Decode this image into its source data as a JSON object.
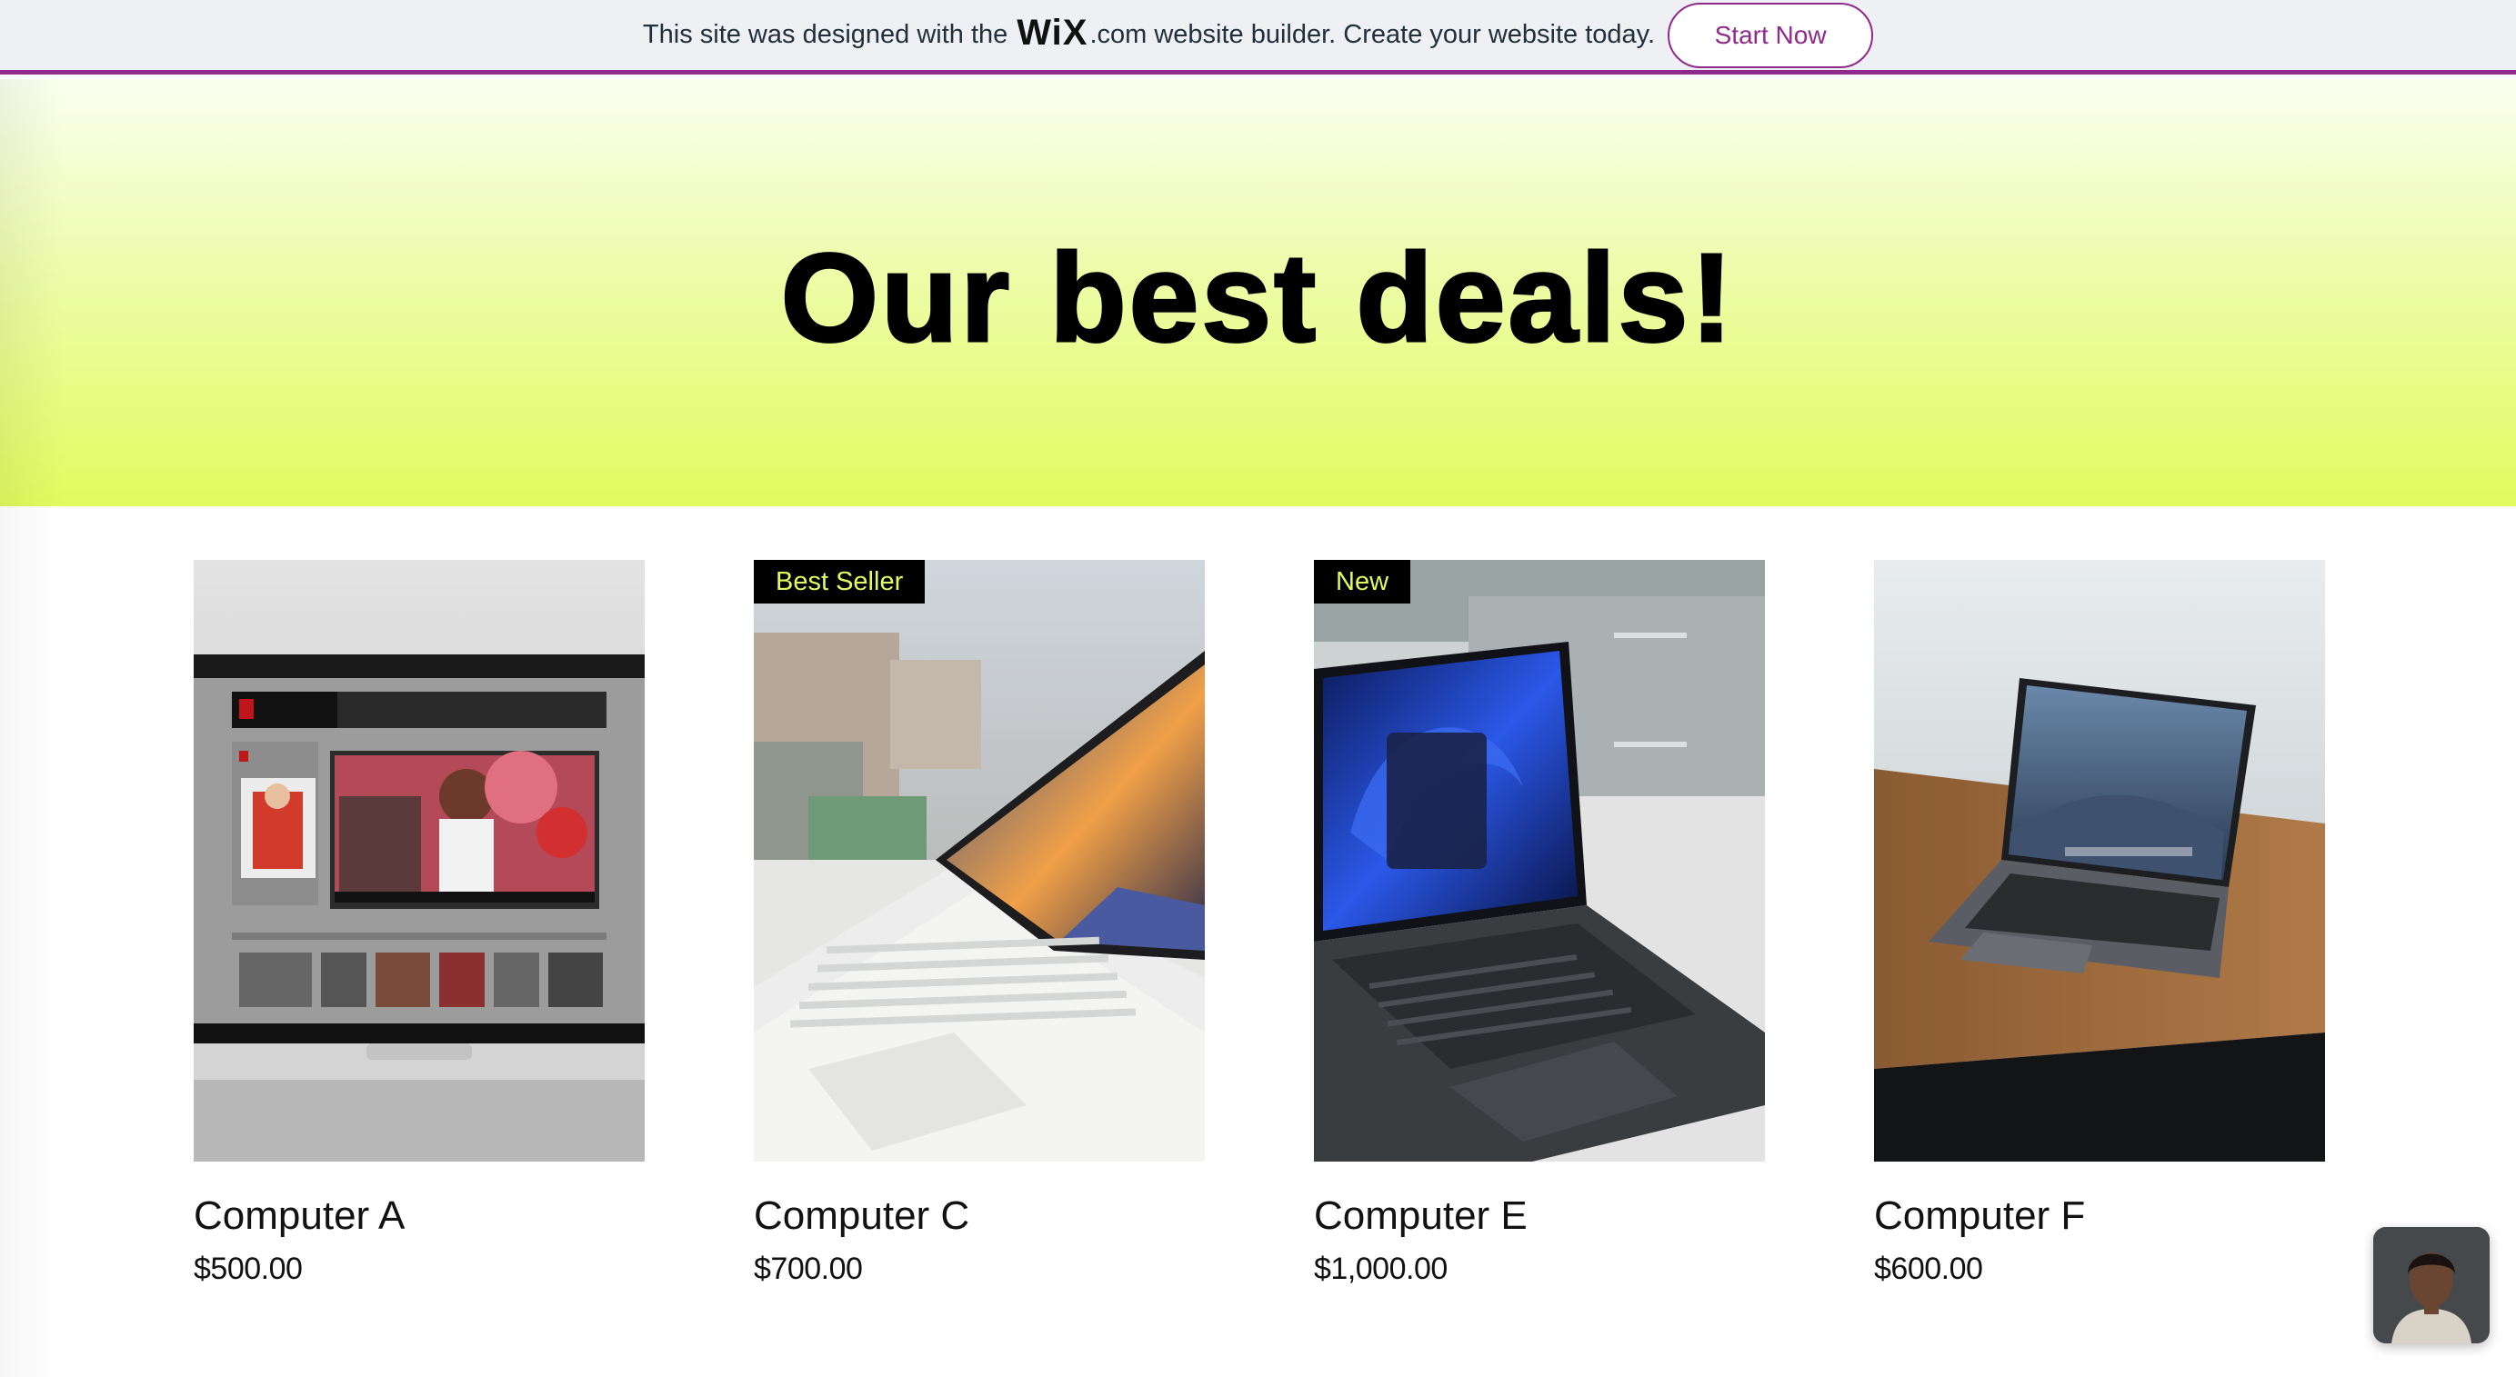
{
  "banner": {
    "text_before": "This site was designed with the",
    "logo": "WiX",
    "logo_suffix": ".com",
    "text_after": "website builder. Create your website today.",
    "button_label": "Start Now",
    "accent_color": "#8e2b8a"
  },
  "hero": {
    "title": "Our best deals!",
    "gradient_colors": [
      "#fbfff0",
      "#e2fb5e"
    ]
  },
  "products": [
    {
      "name": "Computer A",
      "price": "$500.00",
      "ribbon": null,
      "image": "laptop-fashion-site-image"
    },
    {
      "name": "Computer C",
      "price": "$700.00",
      "ribbon": "Best Seller",
      "image": "silver-laptop-city-image"
    },
    {
      "name": "Computer E",
      "price": "$1,000.00",
      "ribbon": "New",
      "image": "dark-laptop-windows-image"
    },
    {
      "name": "Computer F",
      "price": "$600.00",
      "ribbon": null,
      "image": "macbook-desk-image"
    }
  ],
  "ribbon_colors": {
    "background": "#000000",
    "text": "#e2fb5e"
  },
  "chat": {
    "icon": "chat-avatar-icon"
  }
}
